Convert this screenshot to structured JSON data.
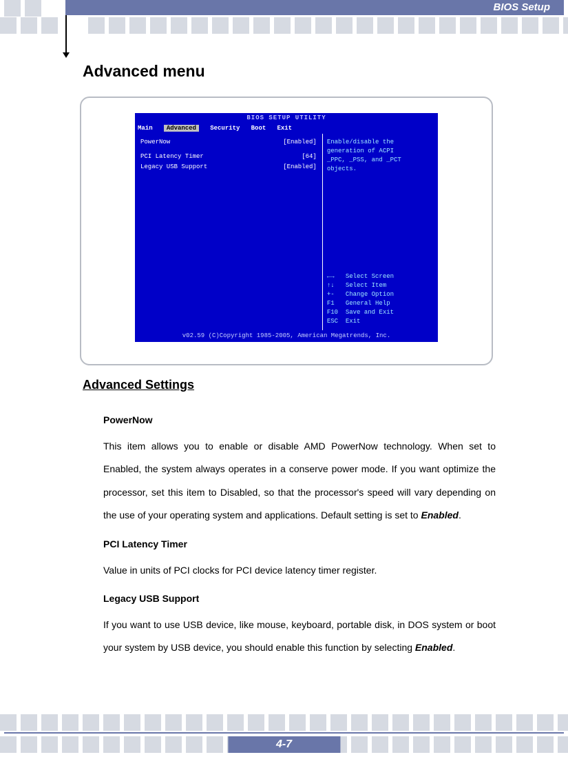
{
  "header": {
    "title": "BIOS Setup"
  },
  "page": {
    "title": "Advanced menu",
    "number": "4-7"
  },
  "bios": {
    "title": "BIOS SETUP UTILITY",
    "menu": {
      "items": [
        "Main",
        "Advanced",
        "Security",
        "Boot",
        "Exit"
      ],
      "selected": "Advanced"
    },
    "rows": [
      {
        "label": "PowerNow",
        "value": "[Enabled]"
      },
      {
        "label": "PCI Latency Timer",
        "value": "[64]"
      },
      {
        "label": "Legacy USB Support",
        "value": "[Enabled]"
      }
    ],
    "help": {
      "desc1": "Enable/disable the",
      "desc2": "generation of ACPI",
      "desc3": "_PPC, _PSS, and _PCT",
      "desc4": "objects.",
      "k1": "←→",
      "k1t": "Select Screen",
      "k2": "↑↓",
      "k2t": "Select Item",
      "k3": "+-",
      "k3t": "Change Option",
      "k4": "F1",
      "k4t": "General Help",
      "k5": "F10",
      "k5t": "Save and Exit",
      "k6": "ESC",
      "k6t": "Exit"
    },
    "footer": "v02.59 (C)Copyright 1985-2005, American Megatrends, Inc."
  },
  "section": {
    "title": "Advanced Settings"
  },
  "content": {
    "h1": "PowerNow",
    "p1a": "This item allows you to enable or disable AMD PowerNow technology. When set to Enabled, the system always operates in a conserve power mode.   If you want optimize the processor, set this item to Disabled, so that the processor's speed will vary depending on the use of your operating system and applications.   Default setting is set to ",
    "p1b": "Enabled",
    "p1c": ".",
    "h2": "PCI Latency Timer",
    "p2": "Value in units of PCI clocks for PCI device latency timer register.",
    "h3": "Legacy USB Support",
    "p3a": "If you want to use USB device, like mouse, keyboard, portable disk, in DOS system or boot your system by USB device, you should enable this function by selecting ",
    "p3b": "Enabled",
    "p3c": "."
  }
}
